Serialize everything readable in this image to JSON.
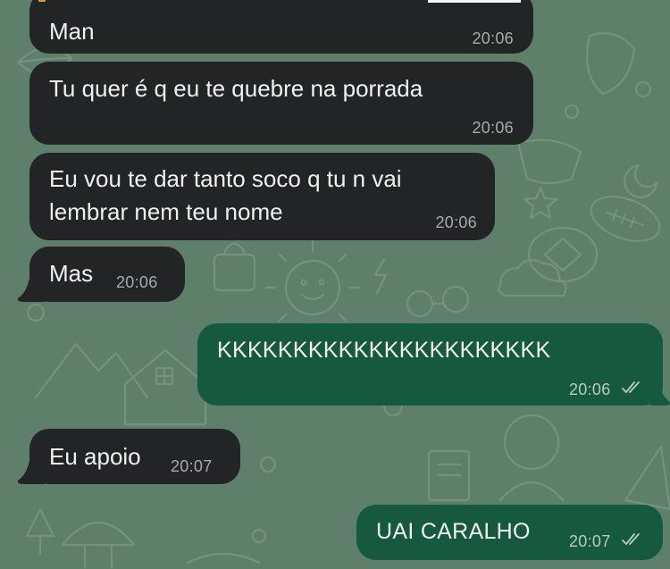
{
  "messages": [
    {
      "text": "Man",
      "time": "20:06",
      "direction": "incoming"
    },
    {
      "text": "Tu quer é q eu te quebre na porrada",
      "time": "20:06",
      "direction": "incoming"
    },
    {
      "text": "Eu vou te dar tanto soco q tu n vai\nlembrar nem teu nome",
      "time": "20:06",
      "direction": "incoming"
    },
    {
      "text": "Mas",
      "time": "20:06",
      "direction": "incoming"
    },
    {
      "text": "KKKKKKKKKKKKKKKKKKKKKK",
      "time": "20:06",
      "direction": "outgoing",
      "status": "read"
    },
    {
      "text": "Eu apoio",
      "time": "20:07",
      "direction": "incoming"
    },
    {
      "text": "UAI CARALHO",
      "time": "20:07",
      "direction": "outgoing",
      "status": "read"
    }
  ],
  "colors": {
    "wallpaper": "#5e7f69",
    "incoming_bubble": "#232426",
    "outgoing_bubble": "#15593f",
    "text": "#f1f1f1"
  }
}
